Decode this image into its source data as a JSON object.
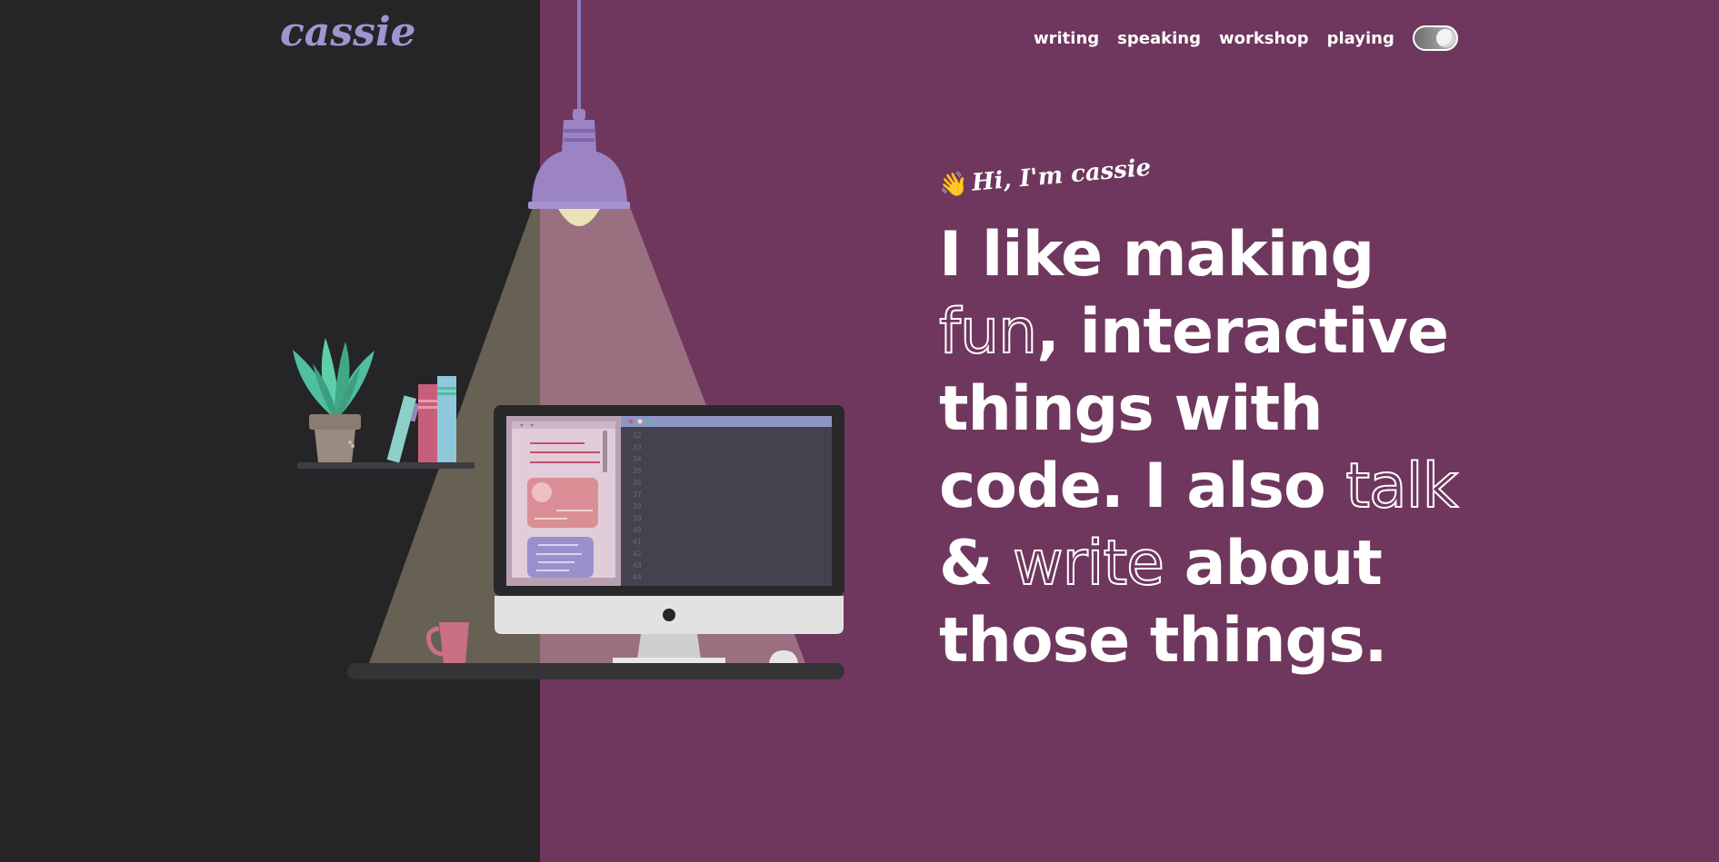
{
  "header": {
    "logo_text": "cassie",
    "nav": [
      {
        "label": "writing"
      },
      {
        "label": "speaking"
      },
      {
        "label": "workshop"
      },
      {
        "label": "playing"
      }
    ]
  },
  "hero": {
    "greeting": "Hi, I'm cassie",
    "greeting_icon": "waving-hand-icon",
    "headline": {
      "part1": "I like making ",
      "word1": "fun",
      "part2": ", interactive things with code. I also ",
      "word2": "talk",
      "part3": " & ",
      "word3": "write",
      "part4": " about those things."
    }
  },
  "illustration": {
    "code_line_numbers": [
      "32",
      "33",
      "34",
      "35",
      "36",
      "37",
      "38",
      "39",
      "40",
      "41",
      "42",
      "43",
      "44"
    ]
  },
  "colors": {
    "left_bg": "#252427",
    "right_bg": "#6f375d",
    "logo": "#9e96d0",
    "lamp": "#9c7bbf",
    "plant": "#4fbf9f"
  }
}
